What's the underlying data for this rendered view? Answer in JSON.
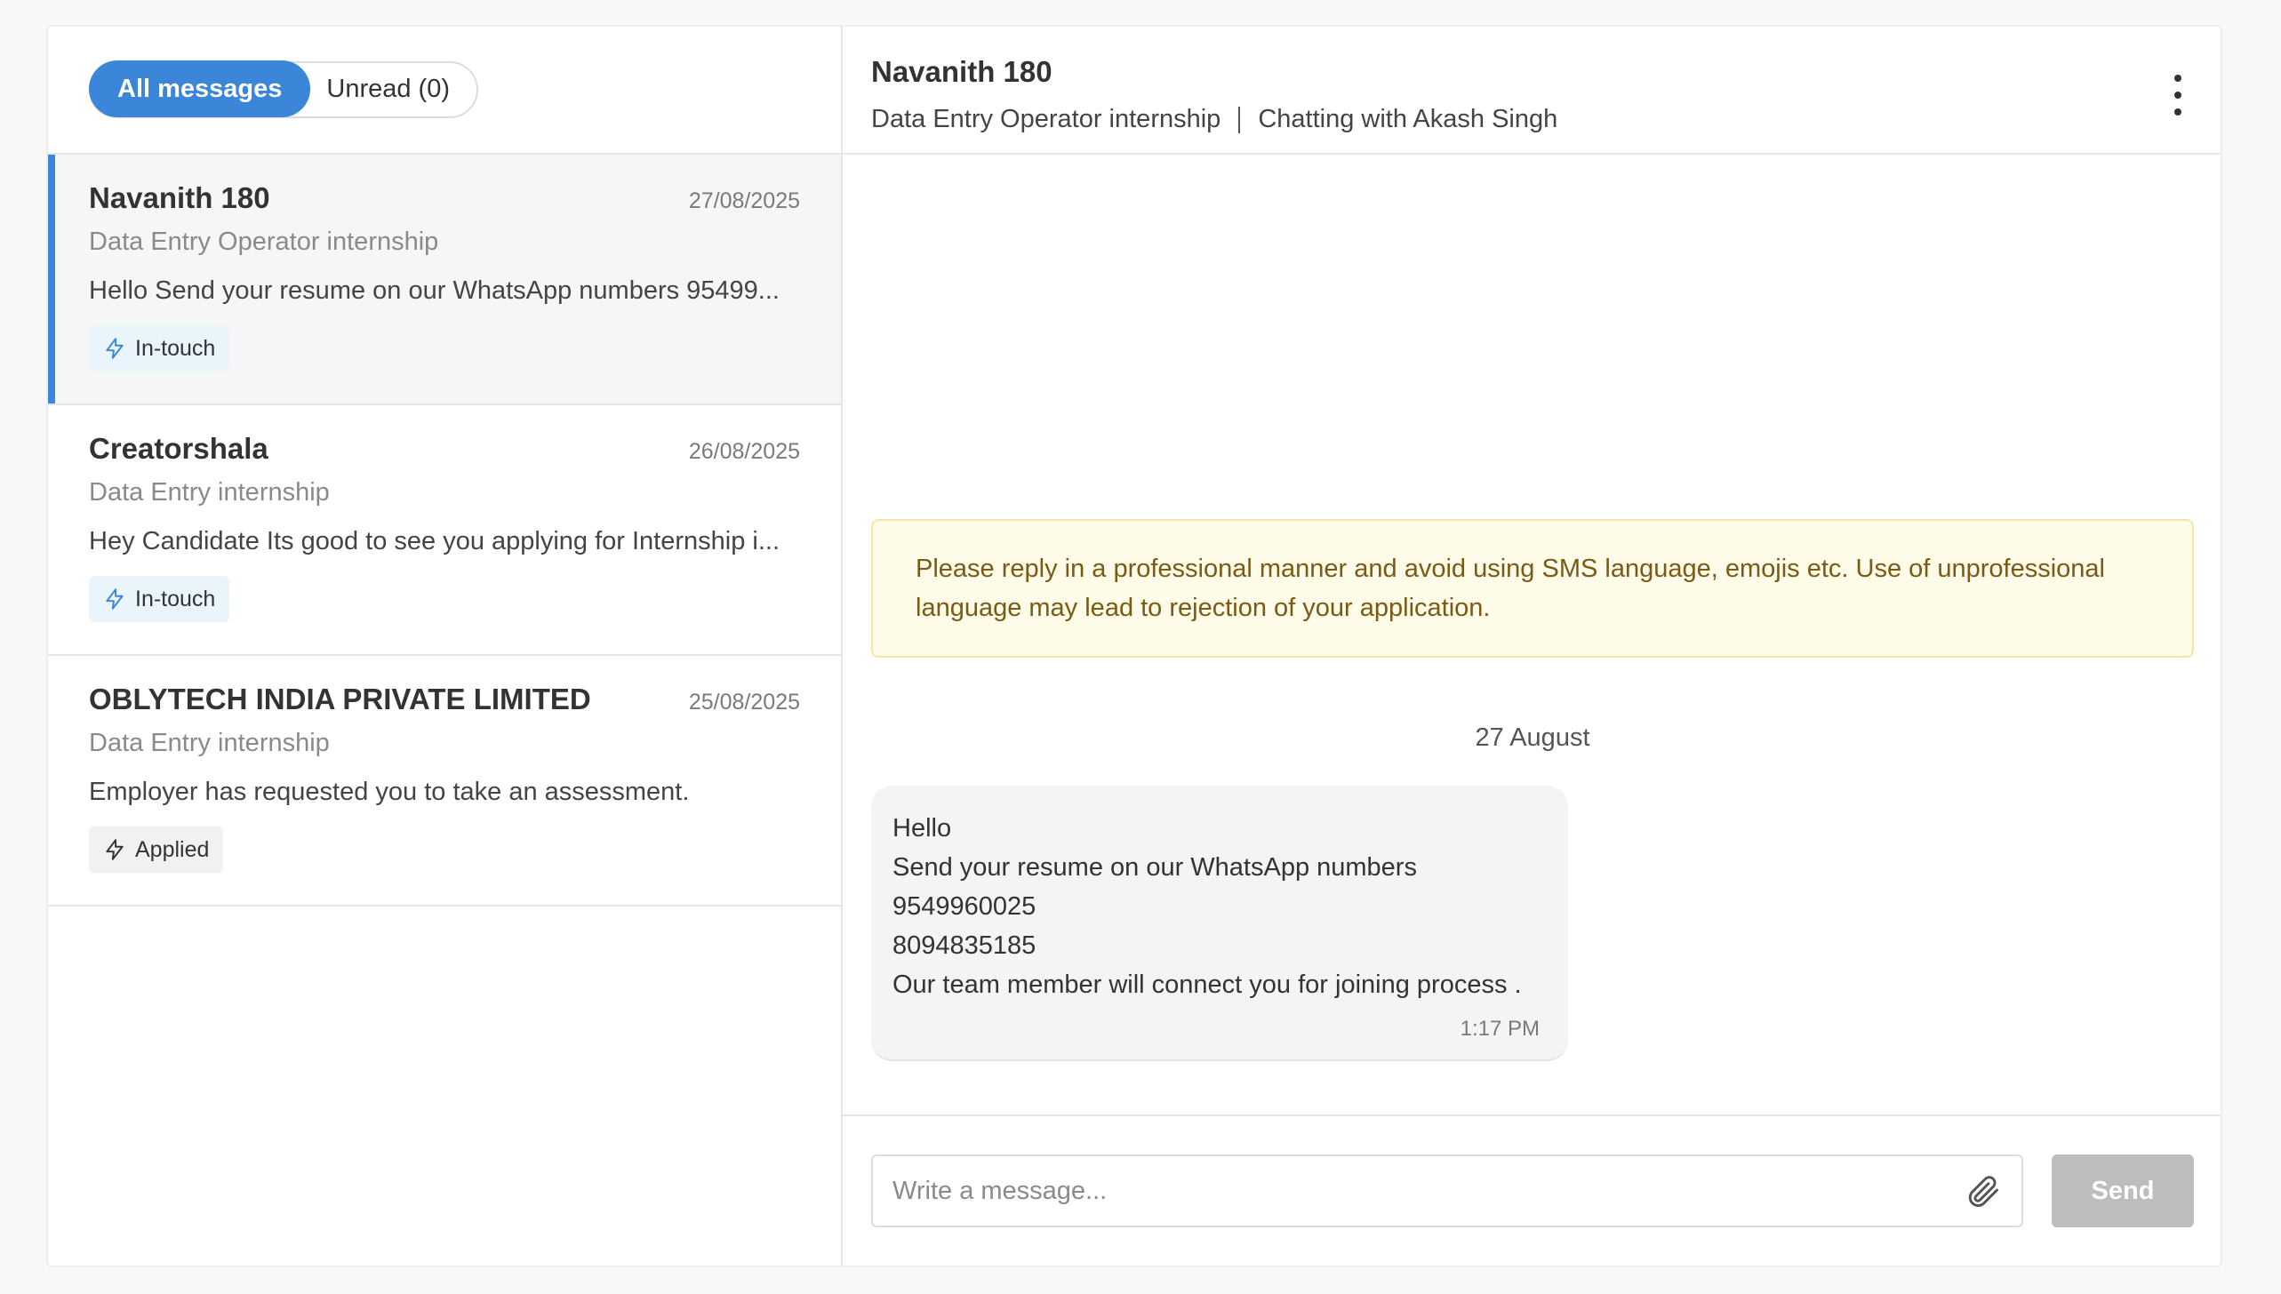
{
  "filters": {
    "all_label": "All messages",
    "unread_label": "Unread (0)"
  },
  "conversations": [
    {
      "name": "Navanith 180",
      "date": "27/08/2025",
      "role": "Data Entry Operator internship",
      "preview": "Hello Send your resume on our WhatsApp numbers 95499...",
      "status": "In-touch",
      "selected": true
    },
    {
      "name": "Creatorshala",
      "date": "26/08/2025",
      "role": "Data Entry internship",
      "preview": "Hey Candidate Its good to see you applying for Internship i...",
      "status": "In-touch",
      "selected": false
    },
    {
      "name": "OBLYTECH INDIA PRIVATE LIMITED",
      "date": "25/08/2025",
      "role": "Data Entry internship",
      "preview": "Employer has requested you to take an assessment.",
      "status": "Applied",
      "selected": false
    }
  ],
  "chat": {
    "title": "Navanith 180",
    "role": "Data Entry Operator internship",
    "chatting_with": "Chatting with Akash Singh",
    "notice_line1": "Please reply in a professional manner and avoid using SMS language, emojis etc. Use of unprofessional",
    "notice_line2": "language may lead to rejection of your application.",
    "date_separator": "27 August",
    "message": {
      "lines": [
        "Hello",
        "Send your resume on our WhatsApp numbers",
        "9549960025",
        "8094835185",
        "Our team member will connect you for joining process ."
      ],
      "time": "1:17 PM"
    }
  },
  "composer": {
    "placeholder": "Write a message...",
    "send_label": "Send"
  },
  "colors": {
    "accent": "#3b86d8",
    "notice_bg": "#fefbe8",
    "notice_text": "#7a5a14",
    "send_disabled": "#bdbdbd"
  },
  "icons": {
    "status": "lightning-icon",
    "attach": "paperclip-icon",
    "more": "more-vertical-icon"
  }
}
